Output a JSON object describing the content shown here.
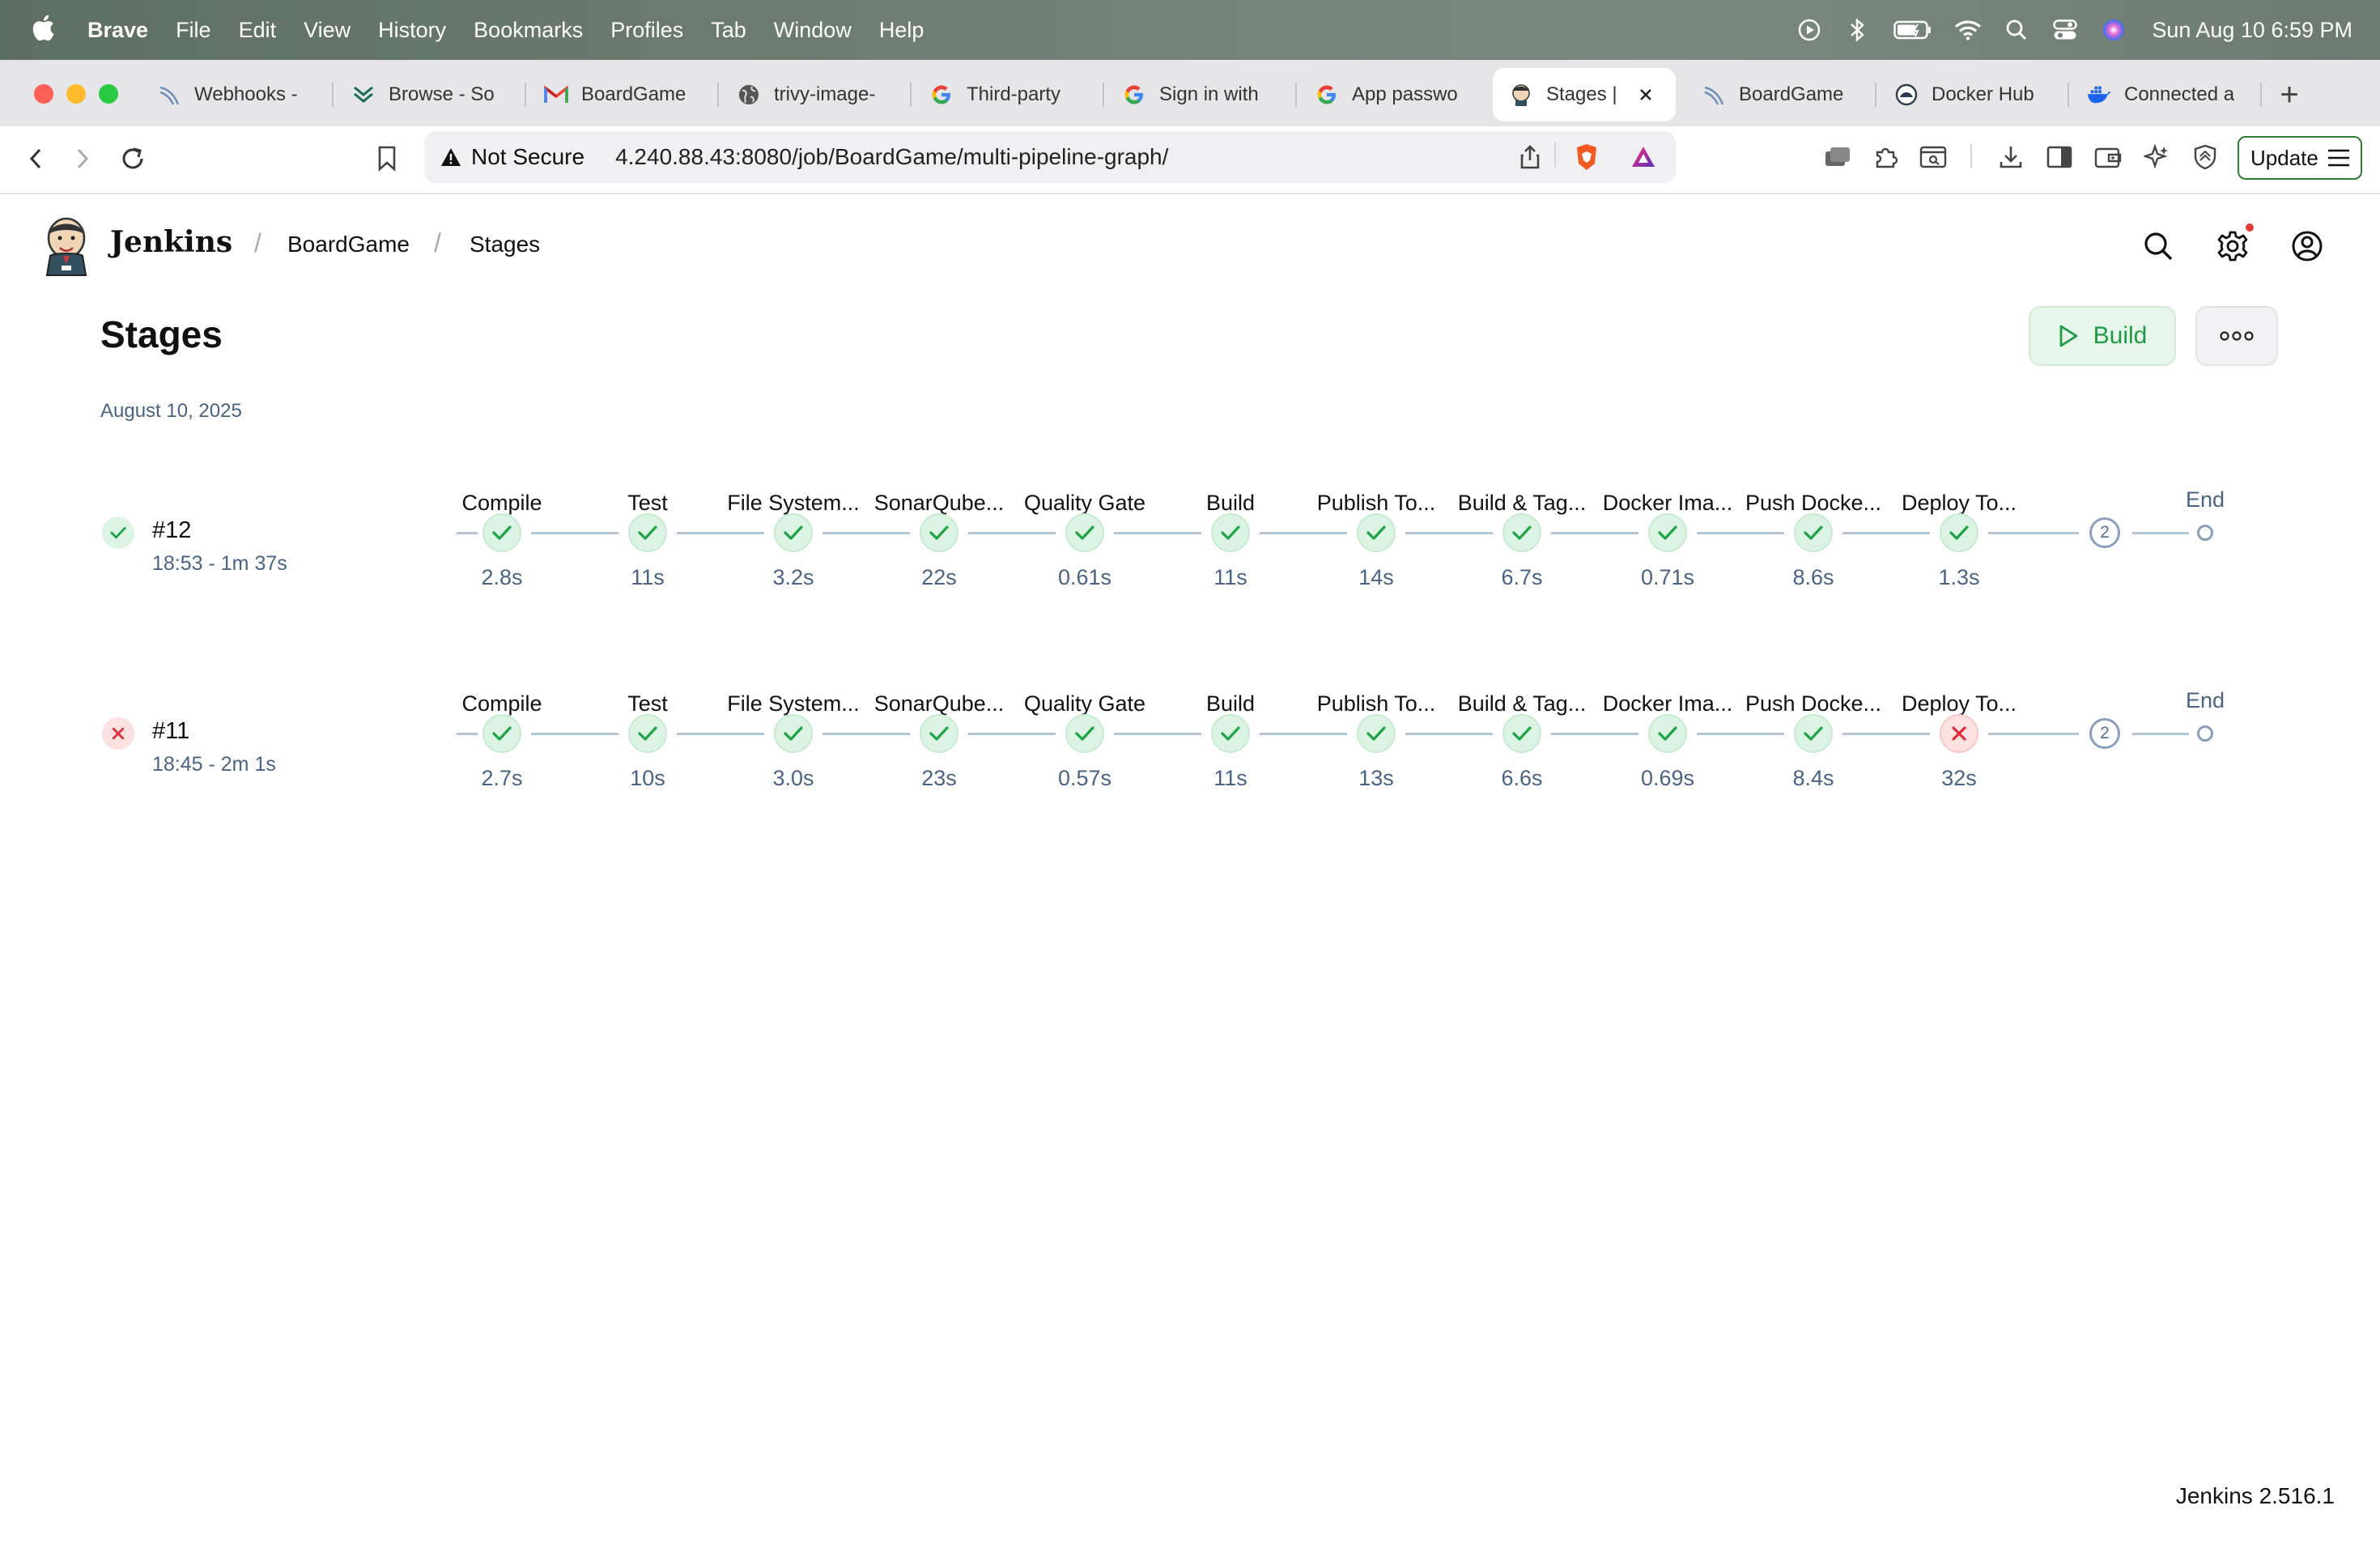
{
  "menubar": {
    "app": "Brave",
    "items": [
      "File",
      "Edit",
      "View",
      "History",
      "Bookmarks",
      "Profiles",
      "Tab",
      "Window",
      "Help"
    ],
    "clock": "Sun Aug 10  6:59 PM",
    "icons": [
      "play-circle-icon",
      "bluetooth-icon",
      "battery-icon",
      "wifi-icon",
      "spotlight-search-icon",
      "control-center-icon",
      "siri-icon"
    ]
  },
  "tabs": [
    {
      "label": "Webhooks -",
      "icon": "webhook-icon"
    },
    {
      "label": "Browse - So",
      "icon": "sonatype-icon"
    },
    {
      "label": "BoardGame",
      "icon": "gmail-icon"
    },
    {
      "label": "trivy-image-",
      "icon": "globe-icon"
    },
    {
      "label": "Third-party",
      "icon": "google-icon"
    },
    {
      "label": "Sign in with",
      "icon": "google-icon"
    },
    {
      "label": "App passwo",
      "icon": "google-icon"
    },
    {
      "label": "Stages |",
      "icon": "jenkins-icon",
      "active": true
    },
    {
      "label": "BoardGame",
      "icon": "webhook-icon"
    },
    {
      "label": "Docker Hub",
      "icon": "docker-hub-icon"
    },
    {
      "label": "Connected a",
      "icon": "docker-icon"
    }
  ],
  "addressbar": {
    "security": "Not Secure",
    "url": "4.240.88.43:8080/job/BoardGame/multi-pipeline-graph/",
    "update_label": "Update"
  },
  "jenkins": {
    "brand": "Jenkins",
    "breadcrumbs": [
      "BoardGame",
      "Stages"
    ],
    "page_title": "Stages",
    "build_label": "Build",
    "date": "August 10, 2025",
    "version": "Jenkins 2.516.1",
    "colors": {
      "success": "#1ea446",
      "failure": "#e02d3c",
      "muted": "#4b6382"
    }
  },
  "runs": [
    {
      "number": "#12",
      "meta": "18:53 - 1m 37s",
      "status": "success",
      "more_count": "2",
      "end_label": "End",
      "stages": [
        {
          "name": "Compile",
          "duration": "2.8s",
          "status": "success"
        },
        {
          "name": "Test",
          "duration": "11s",
          "status": "success"
        },
        {
          "name": "File System...",
          "duration": "3.2s",
          "status": "success"
        },
        {
          "name": "SonarQube...",
          "duration": "22s",
          "status": "success"
        },
        {
          "name": "Quality Gate",
          "duration": "0.61s",
          "status": "success"
        },
        {
          "name": "Build",
          "duration": "11s",
          "status": "success"
        },
        {
          "name": "Publish To...",
          "duration": "14s",
          "status": "success"
        },
        {
          "name": "Build & Tag...",
          "duration": "6.7s",
          "status": "success"
        },
        {
          "name": "Docker Ima...",
          "duration": "0.71s",
          "status": "success"
        },
        {
          "name": "Push Docke...",
          "duration": "8.6s",
          "status": "success"
        },
        {
          "name": "Deploy To...",
          "duration": "1.3s",
          "status": "success"
        }
      ]
    },
    {
      "number": "#11",
      "meta": "18:45 - 2m 1s",
      "status": "failure",
      "more_count": "2",
      "end_label": "End",
      "stages": [
        {
          "name": "Compile",
          "duration": "2.7s",
          "status": "success"
        },
        {
          "name": "Test",
          "duration": "10s",
          "status": "success"
        },
        {
          "name": "File System...",
          "duration": "3.0s",
          "status": "success"
        },
        {
          "name": "SonarQube...",
          "duration": "23s",
          "status": "success"
        },
        {
          "name": "Quality Gate",
          "duration": "0.57s",
          "status": "success"
        },
        {
          "name": "Build",
          "duration": "11s",
          "status": "success"
        },
        {
          "name": "Publish To...",
          "duration": "13s",
          "status": "success"
        },
        {
          "name": "Build & Tag...",
          "duration": "6.6s",
          "status": "success"
        },
        {
          "name": "Docker Ima...",
          "duration": "0.69s",
          "status": "success"
        },
        {
          "name": "Push Docke...",
          "duration": "8.4s",
          "status": "success"
        },
        {
          "name": "Deploy To...",
          "duration": "32s",
          "status": "failure"
        }
      ]
    }
  ]
}
